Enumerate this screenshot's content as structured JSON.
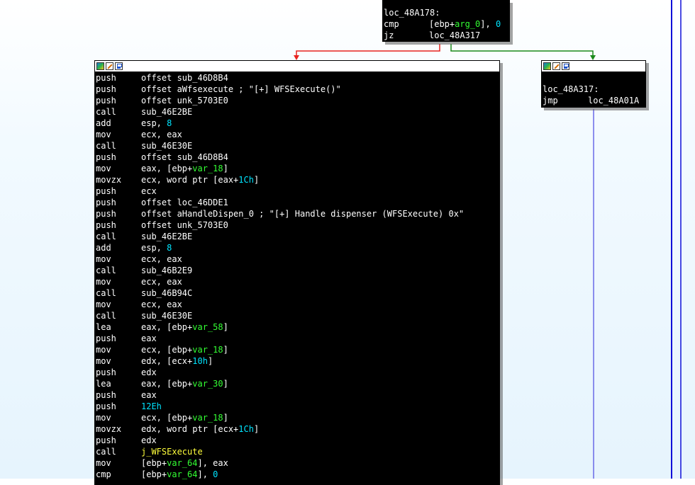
{
  "blocks": {
    "top": {
      "lines": [
        [
          {
            "t": "loc_48A178:"
          }
        ],
        [
          {
            "t": "cmp",
            "c": "mn"
          },
          {
            "t": "[ebp+"
          },
          {
            "t": "arg_0",
            "c": "var"
          },
          {
            "t": "], "
          },
          {
            "t": "0",
            "c": "num"
          }
        ],
        [
          {
            "t": "jz",
            "c": "mn"
          },
          {
            "t": "loc_48A317"
          }
        ]
      ]
    },
    "left": {
      "lines": [
        [
          {
            "t": "push",
            "c": "mn"
          },
          {
            "t": "offset sub_46D8B4"
          }
        ],
        [
          {
            "t": "push",
            "c": "mn"
          },
          {
            "t": "offset aWfsexecute ; \"[+] WFSExecute()\""
          }
        ],
        [
          {
            "t": "push",
            "c": "mn"
          },
          {
            "t": "offset unk_5703E0"
          }
        ],
        [
          {
            "t": "call",
            "c": "mn"
          },
          {
            "t": "sub_46E2BE"
          }
        ],
        [
          {
            "t": "add",
            "c": "mn"
          },
          {
            "t": "esp, "
          },
          {
            "t": "8",
            "c": "num"
          }
        ],
        [
          {
            "t": "mov",
            "c": "mn"
          },
          {
            "t": "ecx, eax"
          }
        ],
        [
          {
            "t": "call",
            "c": "mn"
          },
          {
            "t": "sub_46E30E"
          }
        ],
        [
          {
            "t": "push",
            "c": "mn"
          },
          {
            "t": "offset sub_46D8B4"
          }
        ],
        [
          {
            "t": "mov",
            "c": "mn"
          },
          {
            "t": "eax, [ebp+"
          },
          {
            "t": "var_18",
            "c": "var"
          },
          {
            "t": "]"
          }
        ],
        [
          {
            "t": "movzx",
            "c": "mn"
          },
          {
            "t": "ecx, word ptr [eax+"
          },
          {
            "t": "1Ch",
            "c": "num"
          },
          {
            "t": "]"
          }
        ],
        [
          {
            "t": "push",
            "c": "mn"
          },
          {
            "t": "ecx"
          }
        ],
        [
          {
            "t": "push",
            "c": "mn"
          },
          {
            "t": "offset loc_46DDE1"
          }
        ],
        [
          {
            "t": "push",
            "c": "mn"
          },
          {
            "t": "offset aHandleDispen_0 ; \"[+] Handle dispenser (WFSExecute) 0x\""
          }
        ],
        [
          {
            "t": "push",
            "c": "mn"
          },
          {
            "t": "offset unk_5703E0"
          }
        ],
        [
          {
            "t": "call",
            "c": "mn"
          },
          {
            "t": "sub_46E2BE"
          }
        ],
        [
          {
            "t": "add",
            "c": "mn"
          },
          {
            "t": "esp, "
          },
          {
            "t": "8",
            "c": "num"
          }
        ],
        [
          {
            "t": "mov",
            "c": "mn"
          },
          {
            "t": "ecx, eax"
          }
        ],
        [
          {
            "t": "call",
            "c": "mn"
          },
          {
            "t": "sub_46B2E9"
          }
        ],
        [
          {
            "t": "mov",
            "c": "mn"
          },
          {
            "t": "ecx, eax"
          }
        ],
        [
          {
            "t": "call",
            "c": "mn"
          },
          {
            "t": "sub_46B94C"
          }
        ],
        [
          {
            "t": "mov",
            "c": "mn"
          },
          {
            "t": "ecx, eax"
          }
        ],
        [
          {
            "t": "call",
            "c": "mn"
          },
          {
            "t": "sub_46E30E"
          }
        ],
        [
          {
            "t": "lea",
            "c": "mn"
          },
          {
            "t": "eax, [ebp+"
          },
          {
            "t": "var_58",
            "c": "var"
          },
          {
            "t": "]"
          }
        ],
        [
          {
            "t": "push",
            "c": "mn"
          },
          {
            "t": "eax"
          }
        ],
        [
          {
            "t": "mov",
            "c": "mn"
          },
          {
            "t": "ecx, [ebp+"
          },
          {
            "t": "var_18",
            "c": "var"
          },
          {
            "t": "]"
          }
        ],
        [
          {
            "t": "mov",
            "c": "mn"
          },
          {
            "t": "edx, [ecx+"
          },
          {
            "t": "10h",
            "c": "num"
          },
          {
            "t": "]"
          }
        ],
        [
          {
            "t": "push",
            "c": "mn"
          },
          {
            "t": "edx"
          }
        ],
        [
          {
            "t": "lea",
            "c": "mn"
          },
          {
            "t": "eax, [ebp+"
          },
          {
            "t": "var_30",
            "c": "var"
          },
          {
            "t": "]"
          }
        ],
        [
          {
            "t": "push",
            "c": "mn"
          },
          {
            "t": "eax"
          }
        ],
        [
          {
            "t": "push",
            "c": "mn"
          },
          {
            "t": "12Eh",
            "c": "num"
          }
        ],
        [
          {
            "t": "mov",
            "c": "mn"
          },
          {
            "t": "ecx, [ebp+"
          },
          {
            "t": "var_18",
            "c": "var"
          },
          {
            "t": "]"
          }
        ],
        [
          {
            "t": "movzx",
            "c": "mn"
          },
          {
            "t": "edx, word ptr [ecx+"
          },
          {
            "t": "1Ch",
            "c": "num"
          },
          {
            "t": "]"
          }
        ],
        [
          {
            "t": "push",
            "c": "mn"
          },
          {
            "t": "edx"
          }
        ],
        [
          {
            "t": "call",
            "c": "mn"
          },
          {
            "t": "j_WFSExecute",
            "c": "fn"
          }
        ],
        [
          {
            "t": "mov",
            "c": "mn"
          },
          {
            "t": "[ebp+"
          },
          {
            "t": "var_64",
            "c": "var"
          },
          {
            "t": "], eax"
          }
        ],
        [
          {
            "t": "cmp",
            "c": "mn"
          },
          {
            "t": "[ebp+"
          },
          {
            "t": "var_64",
            "c": "var"
          },
          {
            "t": "], "
          },
          {
            "t": "0",
            "c": "num"
          }
        ]
      ]
    },
    "right": {
      "lines": [
        [
          {
            "t": ""
          }
        ],
        [
          {
            "t": "loc_48A317:"
          }
        ],
        [
          {
            "t": "jmp",
            "c": "mn"
          },
          {
            "t": "loc_48A01A"
          }
        ]
      ]
    }
  },
  "colors": {
    "edge_false": "#e8231f",
    "edge_true": "#1a8a1a",
    "edge_jump": "#6a6ae8",
    "edge_outer": "#1010d8"
  },
  "icons": [
    "graph-icon",
    "edit-icon",
    "graph-overview-icon"
  ]
}
